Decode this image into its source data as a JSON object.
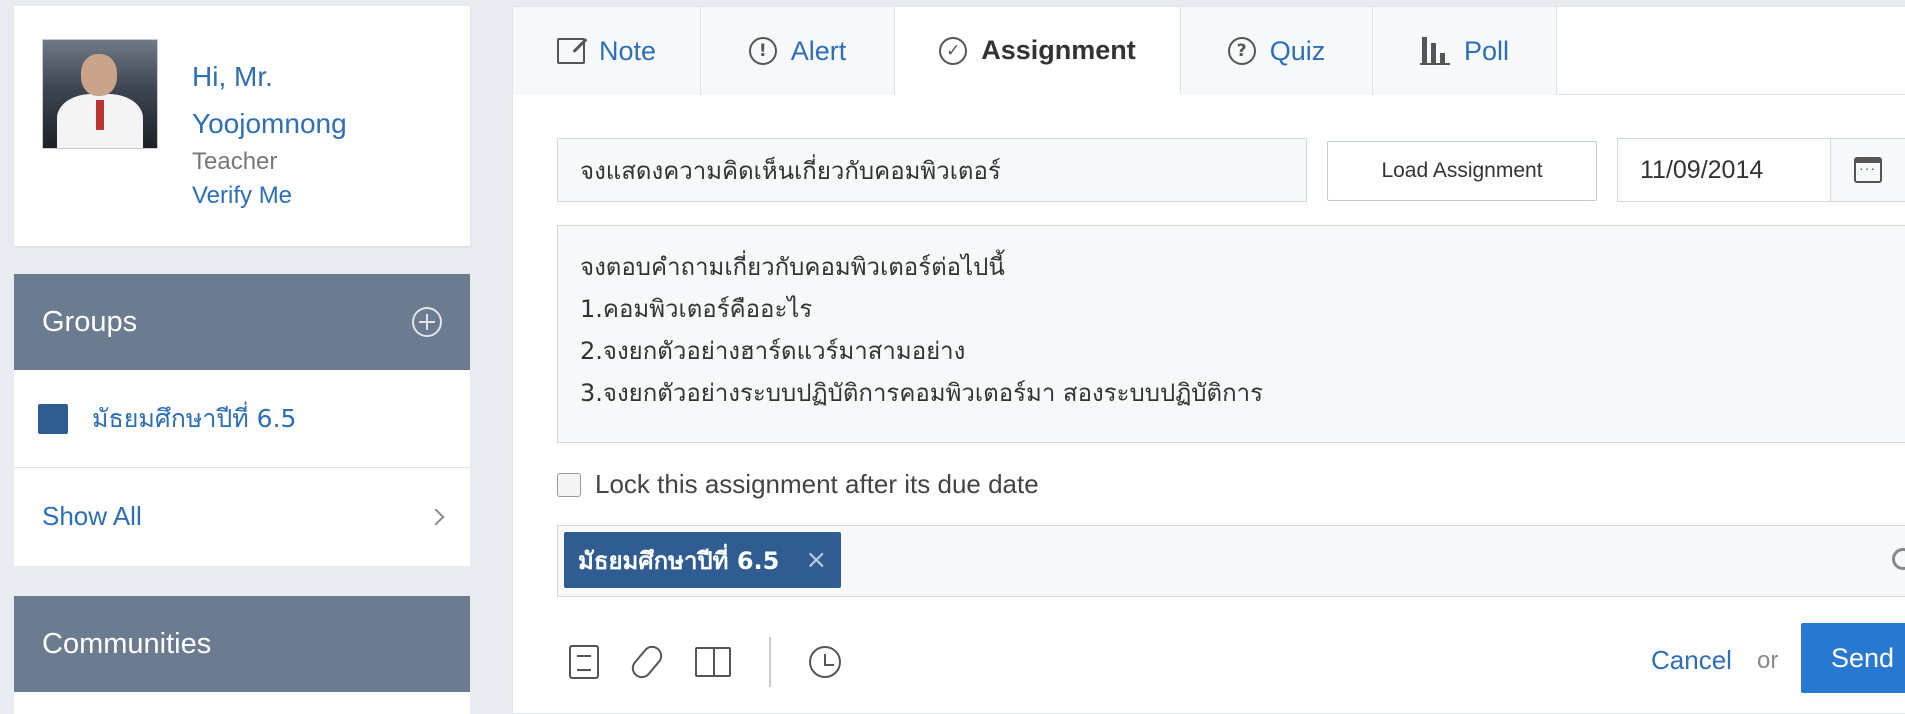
{
  "profile": {
    "greeting_line1": "Hi, Mr.",
    "greeting_line2": "Yoojomnong",
    "role": "Teacher",
    "verify_label": "Verify Me"
  },
  "groups": {
    "title": "Groups",
    "items": [
      {
        "label": "มัธยมศึกษาปีที่ 6.5",
        "color": "#2f5d91"
      }
    ],
    "show_all": "Show All"
  },
  "communities": {
    "title": "Communities"
  },
  "tabs": [
    {
      "label": "Note",
      "icon": "note-icon"
    },
    {
      "label": "Alert",
      "icon": "alert-icon"
    },
    {
      "label": "Assignment",
      "icon": "check-circle-icon",
      "active": true
    },
    {
      "label": "Quiz",
      "icon": "question-icon"
    },
    {
      "label": "Poll",
      "icon": "poll-icon"
    }
  ],
  "assignment": {
    "title_value": "จงแสดงความคิดเห็นเกี่ยวกับคอมพิวเตอร์",
    "load_button": "Load Assignment",
    "due_date": "11/09/2014",
    "description": "จงตอบคำถามเกี่ยวกับคอมพิวเตอร์ต่อไปนี้\n1.คอมพิวเตอร์คืออะไร\n2.จงยกตัวอย่างฮาร์ดแวร์มาสามอย่าง\n3.จงยกตัวอย่างระบบปฏิบัติการคอมพิวเตอร์มา สองระบบปฏิบัติการ",
    "lock_label": "Lock this assignment after its due date",
    "recipient_chip": "มัธยมศึกษาปีที่ 6.5",
    "chip_remove": "×"
  },
  "actions": {
    "cancel": "Cancel",
    "or": "or",
    "send": "Send"
  },
  "colors": {
    "link": "#2d6fb7",
    "sidebar_header": "#6b7b90",
    "send_button": "#2778d0",
    "chip": "#2f5d91"
  }
}
